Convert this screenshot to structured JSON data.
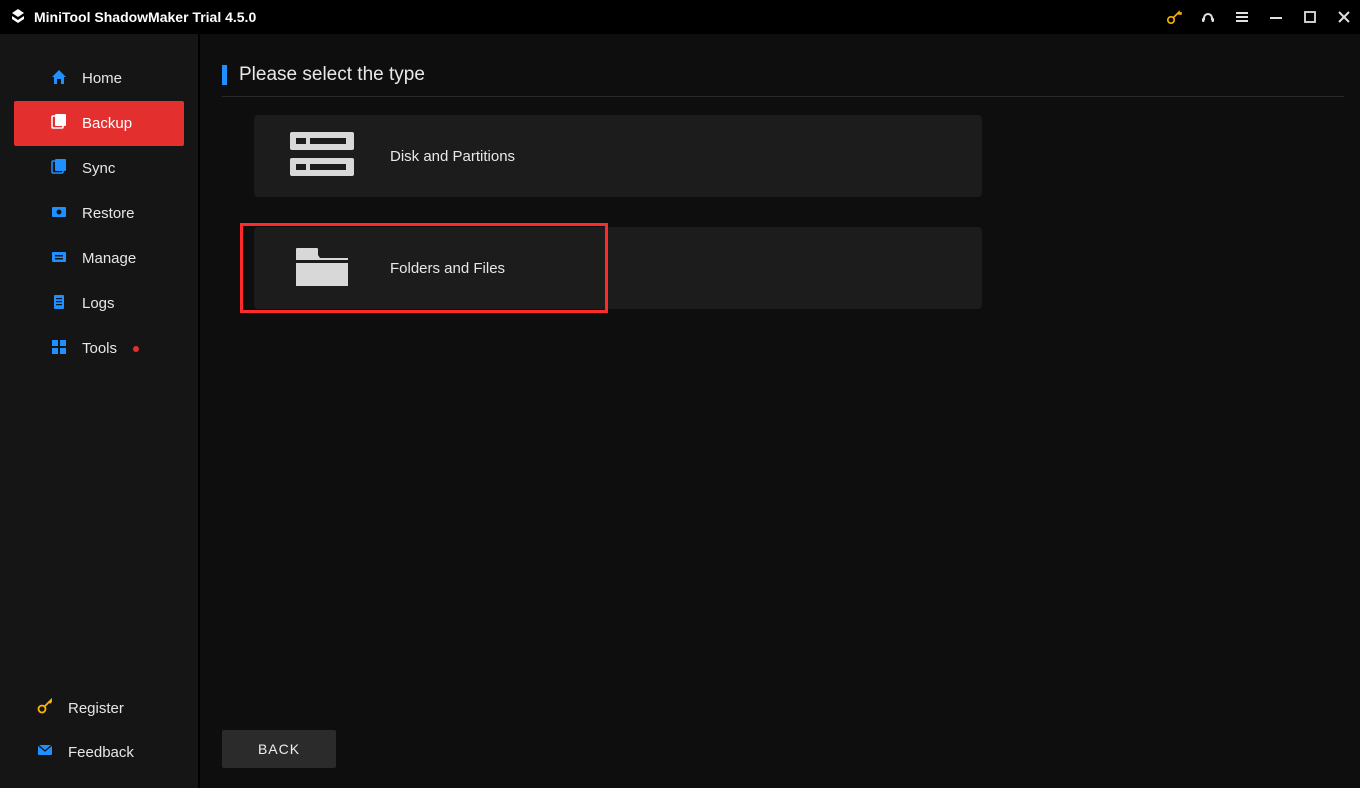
{
  "app": {
    "title": "MiniTool ShadowMaker Trial 4.5.0"
  },
  "titlebar_icons": {
    "key": "key-icon",
    "support": "support-icon",
    "menu": "menu-icon",
    "minimize": "minimize-icon",
    "maximize": "maximize-icon",
    "close": "close-icon"
  },
  "sidebar": {
    "items": [
      {
        "id": "home",
        "label": "Home"
      },
      {
        "id": "backup",
        "label": "Backup"
      },
      {
        "id": "sync",
        "label": "Sync"
      },
      {
        "id": "restore",
        "label": "Restore"
      },
      {
        "id": "manage",
        "label": "Manage"
      },
      {
        "id": "logs",
        "label": "Logs"
      },
      {
        "id": "tools",
        "label": "Tools"
      }
    ],
    "active": "backup",
    "bottom": [
      {
        "id": "register",
        "label": "Register"
      },
      {
        "id": "feedback",
        "label": "Feedback"
      }
    ]
  },
  "page": {
    "header": "Please select the type",
    "options": [
      {
        "id": "disk",
        "label": "Disk and Partitions"
      },
      {
        "id": "folders",
        "label": "Folders and Files",
        "highlighted": true
      }
    ],
    "back_label": "BACK"
  }
}
